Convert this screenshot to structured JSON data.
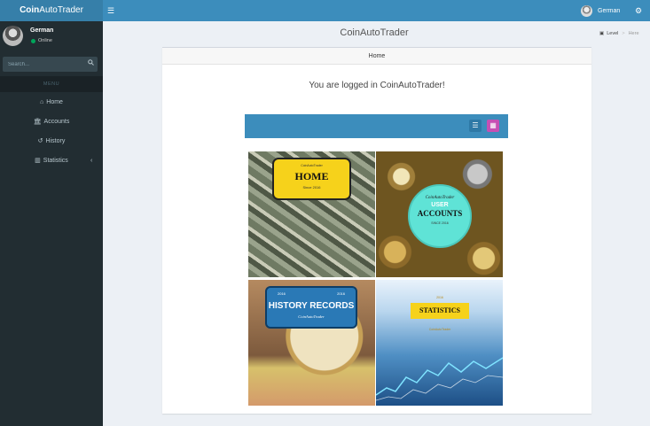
{
  "header": {
    "logo_bold": "Coin",
    "logo_rest": "AutoTrader",
    "user_name": "German",
    "accent": "#3c8dbc",
    "logo_bg": "#367fa9"
  },
  "sidebar": {
    "user_name": "German",
    "status": "Online",
    "search_placeholder": "Search...",
    "menu_header": "MENU",
    "items": [
      {
        "label": "Home",
        "icon": "home-icon"
      },
      {
        "label": "Accounts",
        "icon": "bank-icon"
      },
      {
        "label": "History",
        "icon": "history-icon"
      },
      {
        "label": "Statistics",
        "icon": "bar-chart-icon"
      }
    ],
    "bg": "#222d32"
  },
  "content": {
    "title": "CoinAutoTrader",
    "breadcrumb": {
      "level": "Level",
      "current": "Here"
    },
    "box_title": "Home",
    "welcome": "You are logged in CoinAutoTrader!"
  },
  "tiles": {
    "home": {
      "small": "CoinAutoTrader",
      "big": "HOME",
      "since": "Since 2016"
    },
    "accounts": {
      "script": "CoinAutoTrader",
      "user": "USER",
      "big": "ACCOUNTS",
      "since": "SINCE 2016"
    },
    "history": {
      "left": "2016",
      "right": "2016",
      "big": "HISTORY RECORDS",
      "script": "CoinAutoTrader"
    },
    "statistics": {
      "top": "2016",
      "big": "STATISTICS",
      "sub": "CoinAutoTrader"
    }
  }
}
